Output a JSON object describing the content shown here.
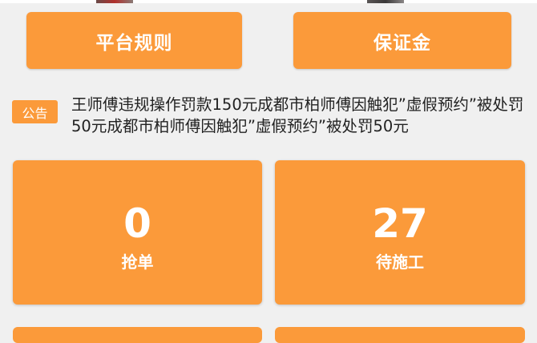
{
  "buttons": {
    "rules_label": "平台规则",
    "deposit_label": "保证金"
  },
  "notice": {
    "tag": "公告",
    "text": "王师傅违规操作罚款150元成都市柏师傅因触犯”虚假预约”被处罚50元成都市柏师傅因触犯”虚假预约”被处罚50元"
  },
  "stats": {
    "grab": {
      "value": "0",
      "label": "抢单"
    },
    "pending": {
      "value": "27",
      "label": "待施工"
    }
  },
  "colors": {
    "accent": "#fb9a3a",
    "background": "#f0f0f0",
    "text": "#222222"
  }
}
